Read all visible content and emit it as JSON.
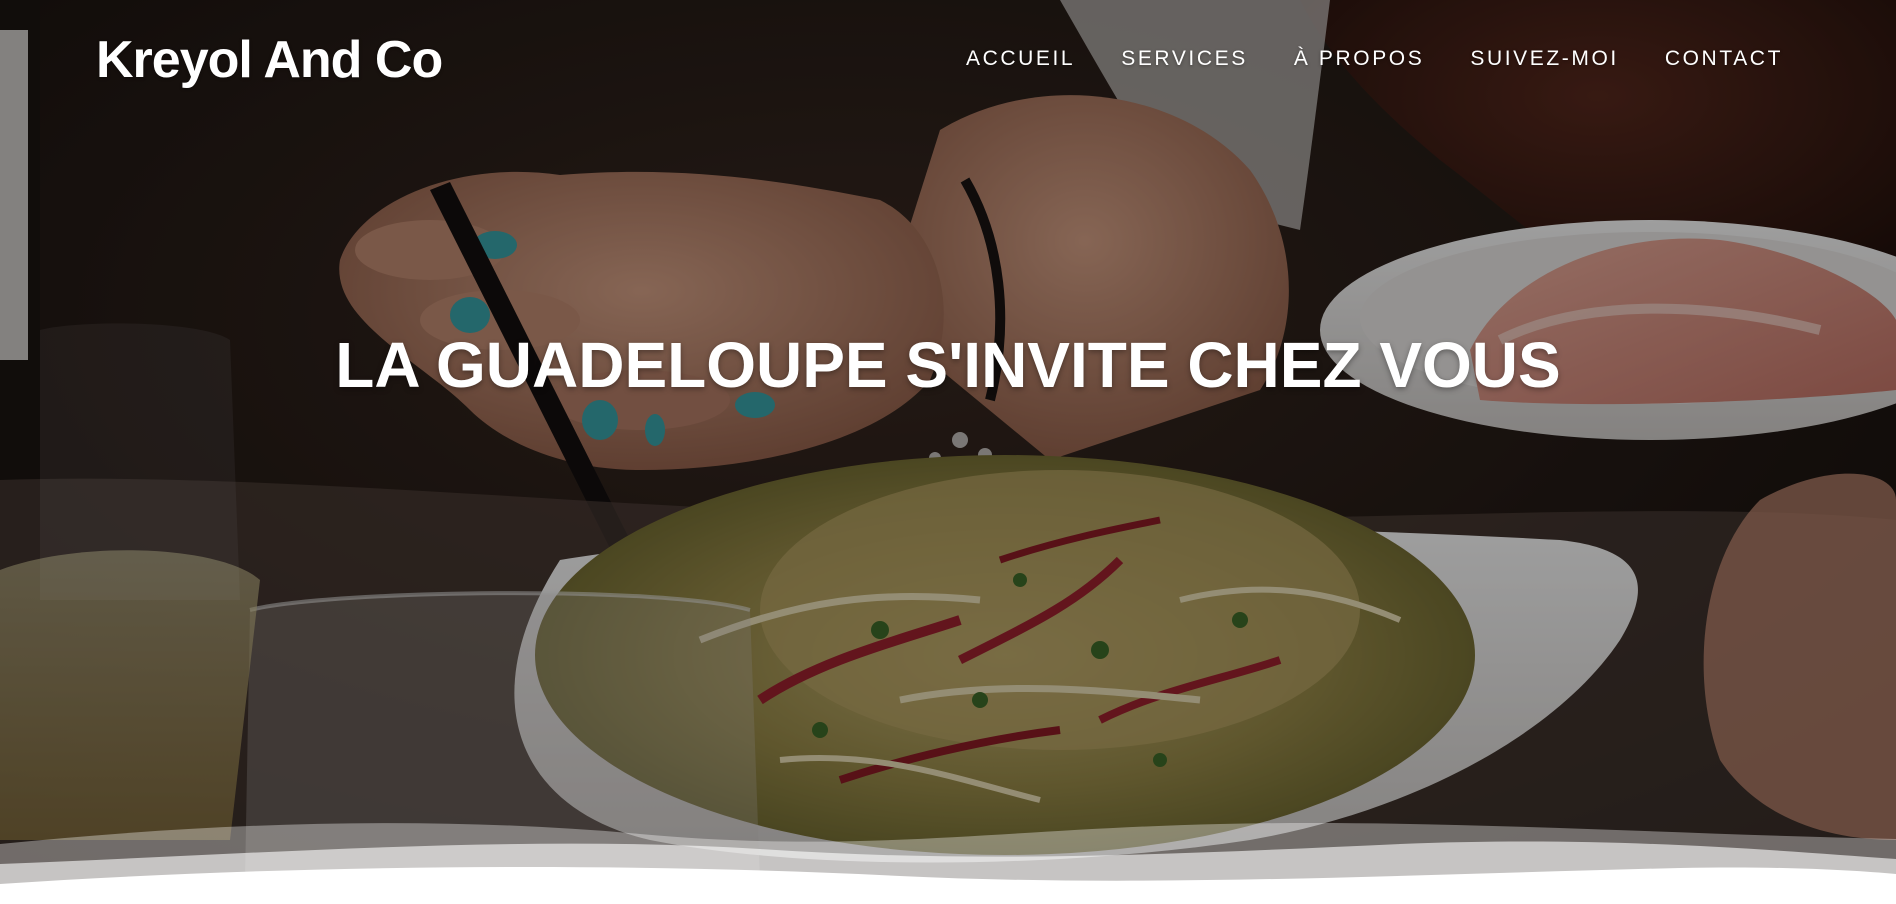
{
  "site": {
    "brand": "Kreyol And Co"
  },
  "nav": {
    "items": [
      {
        "label": "ACCUEIL"
      },
      {
        "label": "SERVICES"
      },
      {
        "label": "À PROPOS"
      },
      {
        "label": "SUIVEZ-MOI"
      },
      {
        "label": "CONTACT"
      }
    ]
  },
  "hero": {
    "headline": "LA GUADELOUPE S'INVITE CHEZ VOUS",
    "image": "dining-salad-photo",
    "overlay_color": "#000000",
    "wave_color": "#ffffff"
  }
}
